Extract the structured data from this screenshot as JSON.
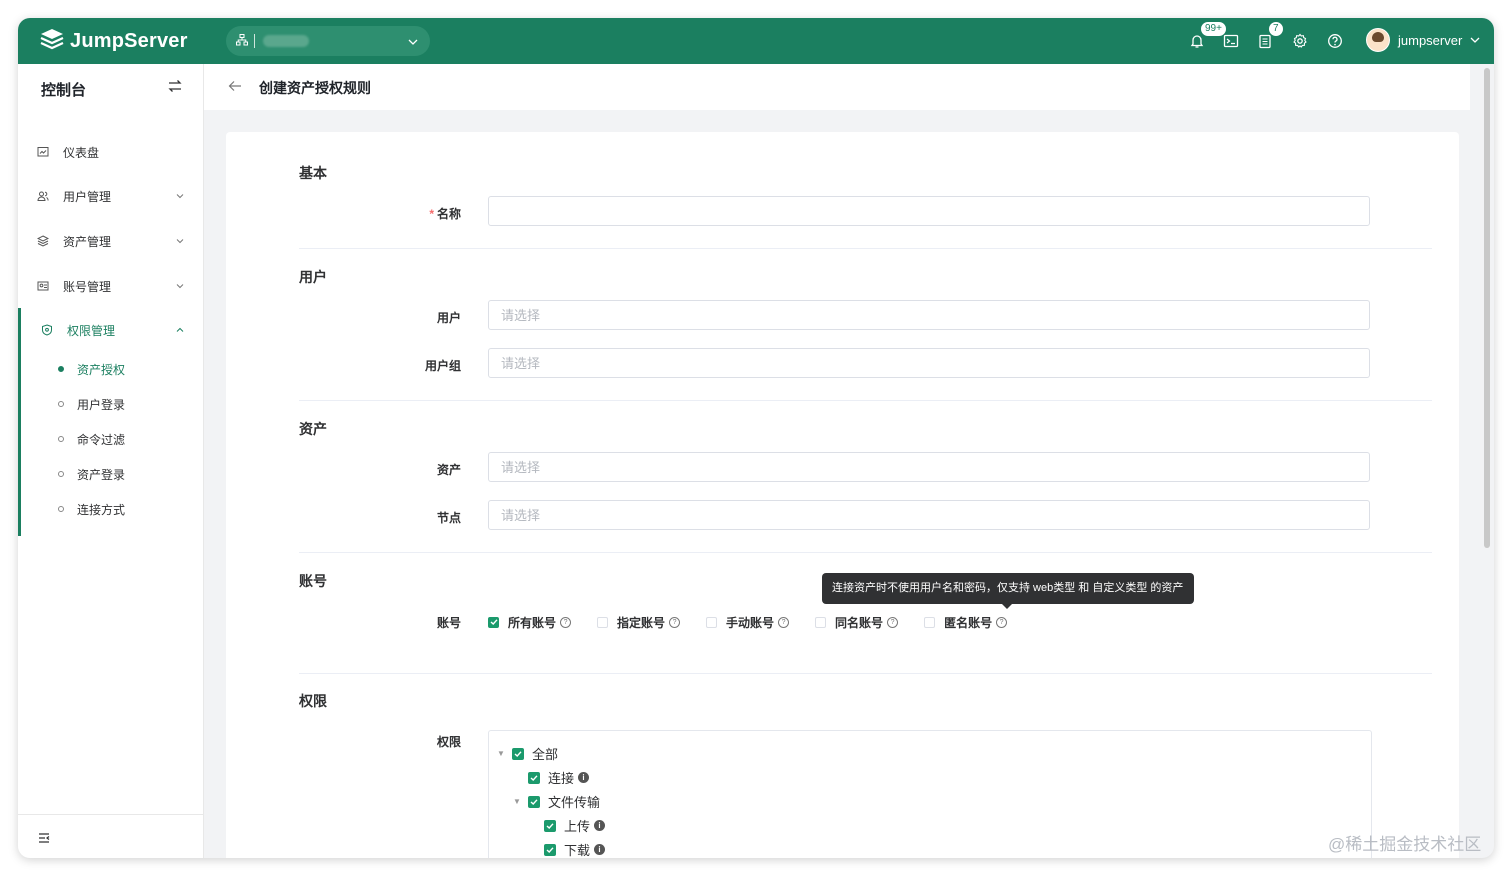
{
  "brand": {
    "name": "JumpServer"
  },
  "topbar": {
    "org_icon": "org-icon",
    "notifications_badge": "99+",
    "tickets_badge": "7",
    "username": "jumpserver",
    "accent": "#1b7f60"
  },
  "sidebar": {
    "title": "控制台",
    "items": [
      {
        "label": "仪表盘",
        "icon": "dashboard-icon"
      },
      {
        "label": "用户管理",
        "icon": "users-icon"
      },
      {
        "label": "资产管理",
        "icon": "assets-icon"
      },
      {
        "label": "账号管理",
        "icon": "accounts-icon"
      },
      {
        "label": "权限管理",
        "icon": "shield-icon"
      }
    ],
    "subitems": [
      {
        "label": "资产授权",
        "active": true
      },
      {
        "label": "用户登录"
      },
      {
        "label": "命令过滤"
      },
      {
        "label": "资产登录"
      },
      {
        "label": "连接方式"
      }
    ]
  },
  "page": {
    "title": "创建资产授权规则"
  },
  "form": {
    "sections": {
      "basic": "基本",
      "user": "用户",
      "asset": "资产",
      "account": "账号",
      "permission": "权限"
    },
    "name_label": "名称",
    "name_required_mark": "*",
    "user_label": "用户",
    "user_placeholder": "请选择",
    "usergroup_label": "用户组",
    "usergroup_placeholder": "请选择",
    "asset_label": "资产",
    "asset_placeholder": "请选择",
    "node_label": "节点",
    "node_placeholder": "请选择",
    "account_label": "账号",
    "account_options": [
      {
        "label": "所有账号",
        "checked": true
      },
      {
        "label": "指定账号",
        "checked": false
      },
      {
        "label": "手动账号",
        "checked": false
      },
      {
        "label": "同名账号",
        "checked": false
      },
      {
        "label": "匿名账号",
        "checked": false
      }
    ],
    "tooltip": "连接资产时不使用用户名和密码，仅支持 web类型 和 自定义类型 的资产",
    "perm_label": "权限",
    "perm_tree": [
      {
        "label": "全部",
        "level": 0,
        "checked": true,
        "expanded": true
      },
      {
        "label": "连接",
        "level": 1,
        "checked": true,
        "info": true
      },
      {
        "label": "文件传输",
        "level": 1,
        "checked": true,
        "expanded": true
      },
      {
        "label": "上传",
        "level": 2,
        "checked": true,
        "info": true
      },
      {
        "label": "下载",
        "level": 2,
        "checked": true,
        "info": true
      }
    ]
  },
  "watermark": "@稀土掘金技术社区"
}
